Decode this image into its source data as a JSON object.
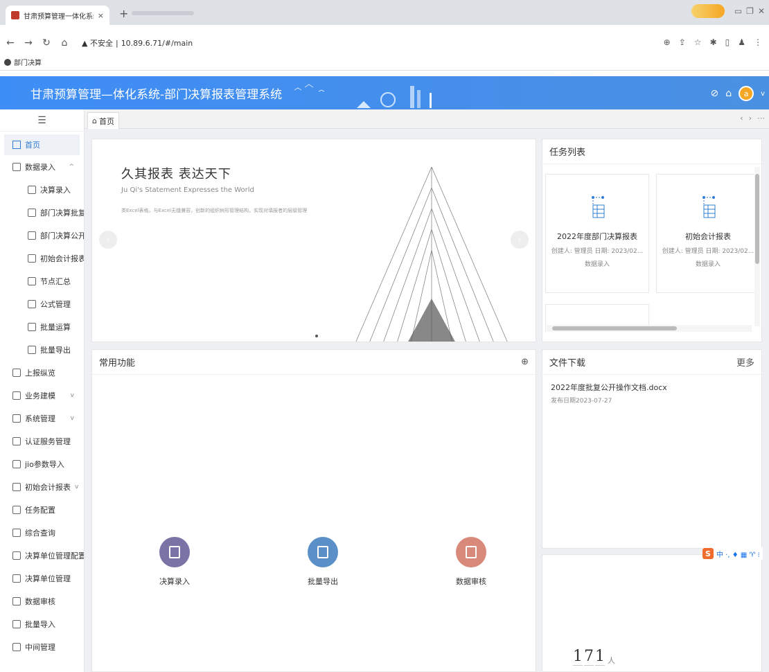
{
  "browser": {
    "tab_title": "甘肃预算管理一体化系统-部门决",
    "new_tab_symbol": "+",
    "tab_close": "×",
    "url_warning": "▲ 不安全",
    "url": "10.89.6.71/#/main",
    "bookmark": "部门决算"
  },
  "header": {
    "title": "甘肃预算管理—体化系统-部门决算报表管理系统",
    "avatar_letter": "a"
  },
  "sidebar": {
    "items": [
      {
        "label": "首页",
        "active": true
      },
      {
        "label": "数据录入",
        "chevron": "^"
      },
      {
        "label": "决算录入",
        "sub": true
      },
      {
        "label": "部门决算批复",
        "sub": true
      },
      {
        "label": "部门决算公开",
        "sub": true
      },
      {
        "label": "初始会计报表",
        "sub": true
      },
      {
        "label": "节点汇总",
        "sub": true
      },
      {
        "label": "公式管理",
        "sub": true
      },
      {
        "label": "批量运算",
        "sub": true
      },
      {
        "label": "批量导出",
        "sub": true
      },
      {
        "label": "上报纵览"
      },
      {
        "label": "业务建模",
        "chevron": "v"
      },
      {
        "label": "系统管理",
        "chevron": "v"
      },
      {
        "label": "认证服务管理"
      },
      {
        "label": "jio参数导入"
      },
      {
        "label": "初始会计报表",
        "chevron": "v"
      },
      {
        "label": "任务配置"
      },
      {
        "label": "综合查询"
      },
      {
        "label": "决算单位管理配置"
      },
      {
        "label": "决算单位管理"
      },
      {
        "label": "数据审核"
      },
      {
        "label": "批量导入"
      },
      {
        "label": "中间管理"
      }
    ]
  },
  "tabstrip": {
    "home_tab": "首页"
  },
  "banner": {
    "title": "久其报表   表达天下",
    "subtitle": "Ju Qi's Statement Expresses the World",
    "small_text": "类Excel表格，与Excel无缝兼容，创新的组织树形管理结构，实现对填报者的层级管理"
  },
  "tasks": {
    "title": "任务列表",
    "cards": [
      {
        "name": "2022年度部门决算报表",
        "meta": "创建人: 管理员  日期: 2023/02...",
        "status": "数据录入"
      },
      {
        "name": "初始会计报表",
        "meta": "创建人: 管理员  日期: 2023/02...",
        "status": "数据录入"
      }
    ]
  },
  "common": {
    "title": "常用功能",
    "add_symbol": "⊕",
    "functions": [
      {
        "label": "决算录入",
        "color": "#7b73a6"
      },
      {
        "label": "批量导出",
        "color": "#5b8fc7"
      },
      {
        "label": "数据审核",
        "color": "#d9897a"
      }
    ]
  },
  "download": {
    "title": "文件下载",
    "more": "更多",
    "file_name": "2022年度批复公开操作文档.docx",
    "file_date": "发布日期2023-07-27"
  },
  "visitor": {
    "digits": [
      "1",
      "7",
      "1"
    ],
    "unit": "人"
  },
  "ime": {
    "logo": "S",
    "text": "中 ·, ♦ ▦ ♈ ⁝"
  },
  "colors": {
    "header_blue": "#3e8ef7",
    "active_blue": "#2f7bd5"
  }
}
